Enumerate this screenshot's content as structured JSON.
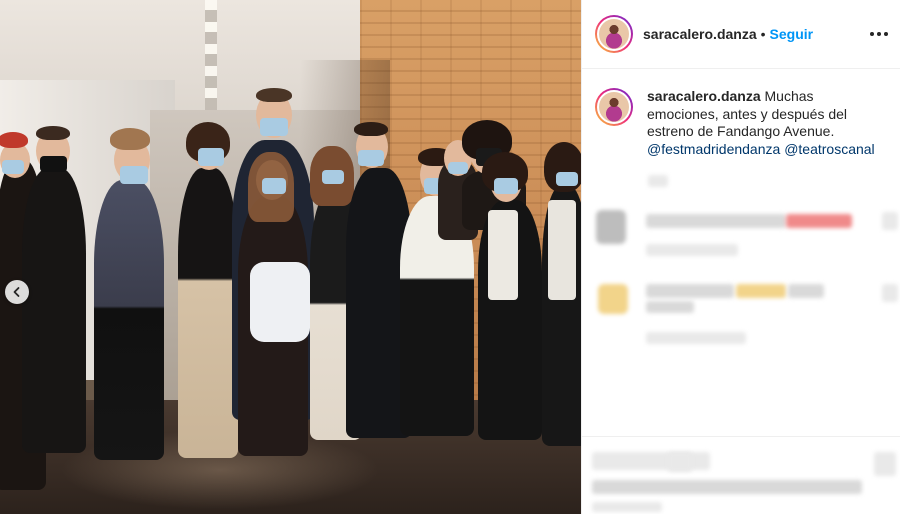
{
  "post": {
    "username": "saracalero.danza",
    "separator": "•",
    "follow_label": "Seguir",
    "caption_username": "saracalero.danza",
    "caption_text": " Muchas emociones, antes y después del estreno de Fandango Avenue.",
    "tag_1": "@festmadridendanza",
    "tag_2": "@teatroscanal"
  },
  "icons": {
    "more": "more-options-icon",
    "carousel_prev": "chevron-left-icon"
  },
  "colors": {
    "follow": "#0095f6",
    "tag": "#00376b",
    "text": "#262626"
  }
}
